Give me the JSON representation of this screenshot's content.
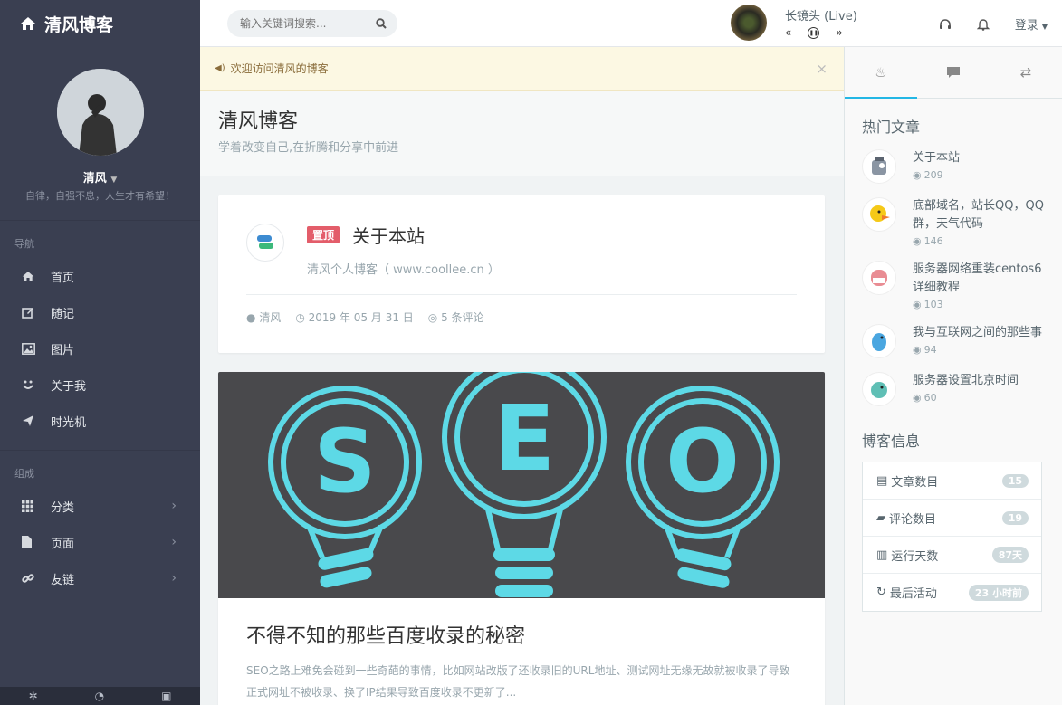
{
  "brand": {
    "title": "清风博客"
  },
  "profile": {
    "name": "清风",
    "motto": "自律，自强不息，人生才有希望！"
  },
  "nav": {
    "header": "导航",
    "items": [
      {
        "label": "首页"
      },
      {
        "label": "随记"
      },
      {
        "label": "图片"
      },
      {
        "label": "关于我"
      },
      {
        "label": "时光机"
      }
    ],
    "group_header": "组成",
    "group_items": [
      {
        "label": "分类"
      },
      {
        "label": "页面"
      },
      {
        "label": "友链"
      }
    ]
  },
  "search": {
    "placeholder": "输入关键词搜索..."
  },
  "player": {
    "title": "长镜头 (Live)"
  },
  "topbar": {
    "login": "登录"
  },
  "notice": {
    "text": "欢迎访问清风的博客"
  },
  "header": {
    "title": "清风博客",
    "subtitle": "学着改变自己,在折腾和分享中前进"
  },
  "post1": {
    "badge": "置顶",
    "title": "关于本站",
    "subtitle": "清风个人博客（ www.coollee.cn ）",
    "author": "清风",
    "date": "2019 年 05 月 31 日",
    "comments": "5 条评论"
  },
  "post2": {
    "image_text": "SEO",
    "title": "不得不知的那些百度收录的秘密",
    "excerpt": "SEO之路上难免会碰到一些奇葩的事情，比如网站改版了还收录旧的URL地址、测试网址无缘无故就被收录了导致正式网址不被收录、换了IP结果导致百度收录不更新了..."
  },
  "hot": {
    "title": "热门文章",
    "items": [
      {
        "title": "关于本站",
        "views": "209"
      },
      {
        "title": "底部域名，站长QQ，QQ群，天气代码",
        "views": "146"
      },
      {
        "title": "服务器网络重装centos6详细教程",
        "views": "103"
      },
      {
        "title": "我与互联网之间的那些事",
        "views": "94"
      },
      {
        "title": "服务器设置北京时间",
        "views": "60"
      }
    ]
  },
  "blog_info": {
    "title": "博客信息",
    "rows": [
      {
        "label": "文章数目",
        "value": "15"
      },
      {
        "label": "评论数目",
        "value": "19"
      },
      {
        "label": "运行天数",
        "value": "87天"
      },
      {
        "label": "最后活动",
        "value": "23 小时前"
      }
    ]
  },
  "colors": {
    "sidebar": "#3a3f51",
    "accent": "#23b7e5",
    "badge": "#e35d6a",
    "seo": "#5dd9e6"
  }
}
